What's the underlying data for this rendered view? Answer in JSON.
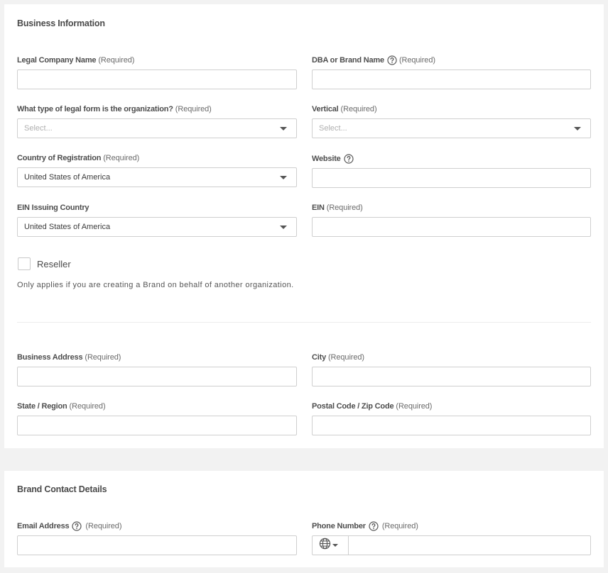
{
  "business": {
    "title": "Business Information",
    "legal_name": {
      "label": "Legal Company Name",
      "required": "(Required)",
      "value": ""
    },
    "dba": {
      "label": "DBA or Brand Name",
      "required": "(Required)",
      "value": "",
      "icon": "help-circle-icon"
    },
    "legal_form": {
      "label": "What type of legal form is the organization?",
      "required": "(Required)",
      "placeholder": "Select..."
    },
    "vertical": {
      "label": "Vertical",
      "required": "(Required)",
      "placeholder": "Select..."
    },
    "country_registration": {
      "label": "Country of Registration",
      "required": "(Required)",
      "value": "United States of America"
    },
    "website": {
      "label": "Website",
      "value": "",
      "icon": "help-circle-icon"
    },
    "ein_country": {
      "label": "EIN Issuing Country",
      "value": "United States of America"
    },
    "ein": {
      "label": "EIN",
      "required": "(Required)",
      "value": ""
    },
    "reseller": {
      "label": "Reseller",
      "checked": false,
      "helper": "Only applies if you are creating a Brand on behalf of another organization."
    },
    "address": {
      "label": "Business Address",
      "required": "(Required)",
      "value": ""
    },
    "city": {
      "label": "City",
      "required": "(Required)",
      "value": ""
    },
    "state": {
      "label": "State / Region",
      "required": "(Required)",
      "value": ""
    },
    "postal": {
      "label": "Postal Code / Zip Code",
      "required": "(Required)",
      "value": ""
    }
  },
  "contact": {
    "title": "Brand Contact Details",
    "email": {
      "label": "Email Address",
      "required": "(Required)",
      "value": "",
      "icon": "help-circle-icon"
    },
    "phone": {
      "label": "Phone Number",
      "required": "(Required)",
      "value": "",
      "icon": "help-circle-icon",
      "prefix_icon": "globe-icon"
    }
  },
  "colors": {
    "border": "#cfcfcf",
    "panel": "#ffffff",
    "page_bg": "#f2f2f2",
    "label": "#4d4d4d"
  }
}
